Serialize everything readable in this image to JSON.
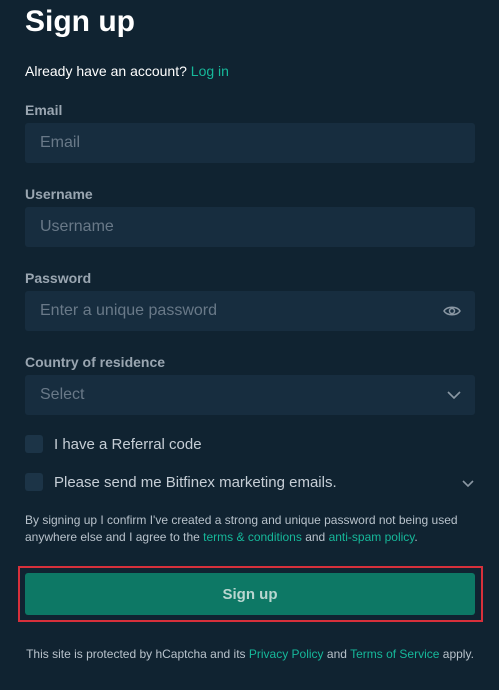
{
  "page": {
    "title": "Sign up",
    "login_prompt": "Already have an account?",
    "login_link": "Log in"
  },
  "form": {
    "email": {
      "label": "Email",
      "placeholder": "Email",
      "value": ""
    },
    "username": {
      "label": "Username",
      "placeholder": "Username",
      "value": ""
    },
    "password": {
      "label": "Password",
      "placeholder": "Enter a unique password",
      "value": ""
    },
    "country": {
      "label": "Country of residence",
      "selected": "Select"
    },
    "referral_checkbox_label": "I have a Referral code",
    "marketing_checkbox_label": "Please send me Bitfinex marketing emails."
  },
  "consent": {
    "text_before": "By signing up I confirm I've created a strong and unique password not being used anywhere else and I agree to the",
    "terms_link": "terms & conditions",
    "and": "and",
    "antispam_link": "anti-spam policy",
    "period": "."
  },
  "submit": {
    "label": "Sign up"
  },
  "footer": {
    "text_before": "This site is protected by hCaptcha and its",
    "privacy_link": "Privacy Policy",
    "and": "and",
    "terms_link": "Terms of Service",
    "text_after": "apply."
  },
  "colors": {
    "background": "#102331",
    "input_bg": "#172d3f",
    "accent": "#16b89a",
    "button_bg": "#0d7865",
    "highlight": "#d7303b"
  },
  "icons": {
    "password_toggle": "eye-icon",
    "country_dropdown": "chevron-down-icon",
    "marketing_expand": "chevron-down-icon"
  }
}
